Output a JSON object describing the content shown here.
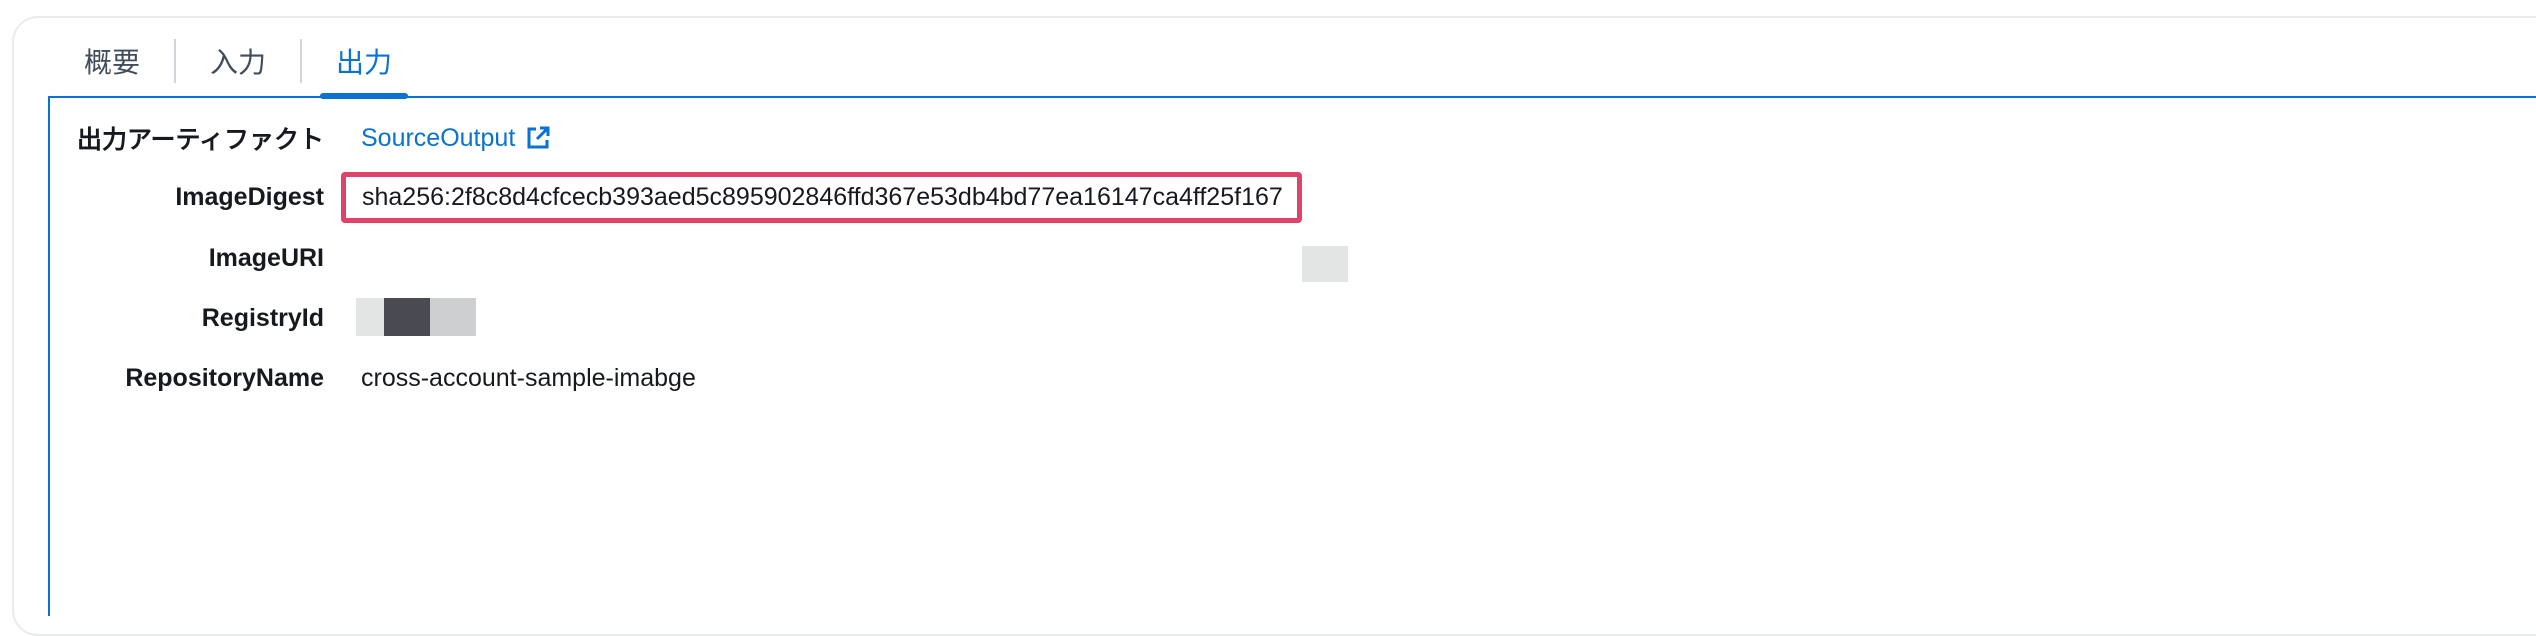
{
  "tabs": [
    {
      "label": "概要",
      "active": false
    },
    {
      "label": "入力",
      "active": false
    },
    {
      "label": "出力",
      "active": true
    }
  ],
  "details": {
    "output_artifact": {
      "label": "出力アーティファクト",
      "value": "SourceOutput",
      "icon": "external-link-icon"
    },
    "image_digest": {
      "label": "ImageDigest",
      "value": "sha256:2f8c8d4cfcecb393aed5c895902846ffd367e53db4bd77ea16147ca4ff25f167"
    },
    "image_uri": {
      "label": "ImageURI",
      "value": ""
    },
    "registry_id": {
      "label": "RegistryId",
      "value": ""
    },
    "repository_name": {
      "label": "RepositoryName",
      "value": "cross-account-sample-imabge"
    }
  },
  "colors": {
    "accent": "#0972d3",
    "highlight_border": "#e0426a",
    "text": "#16191f"
  }
}
